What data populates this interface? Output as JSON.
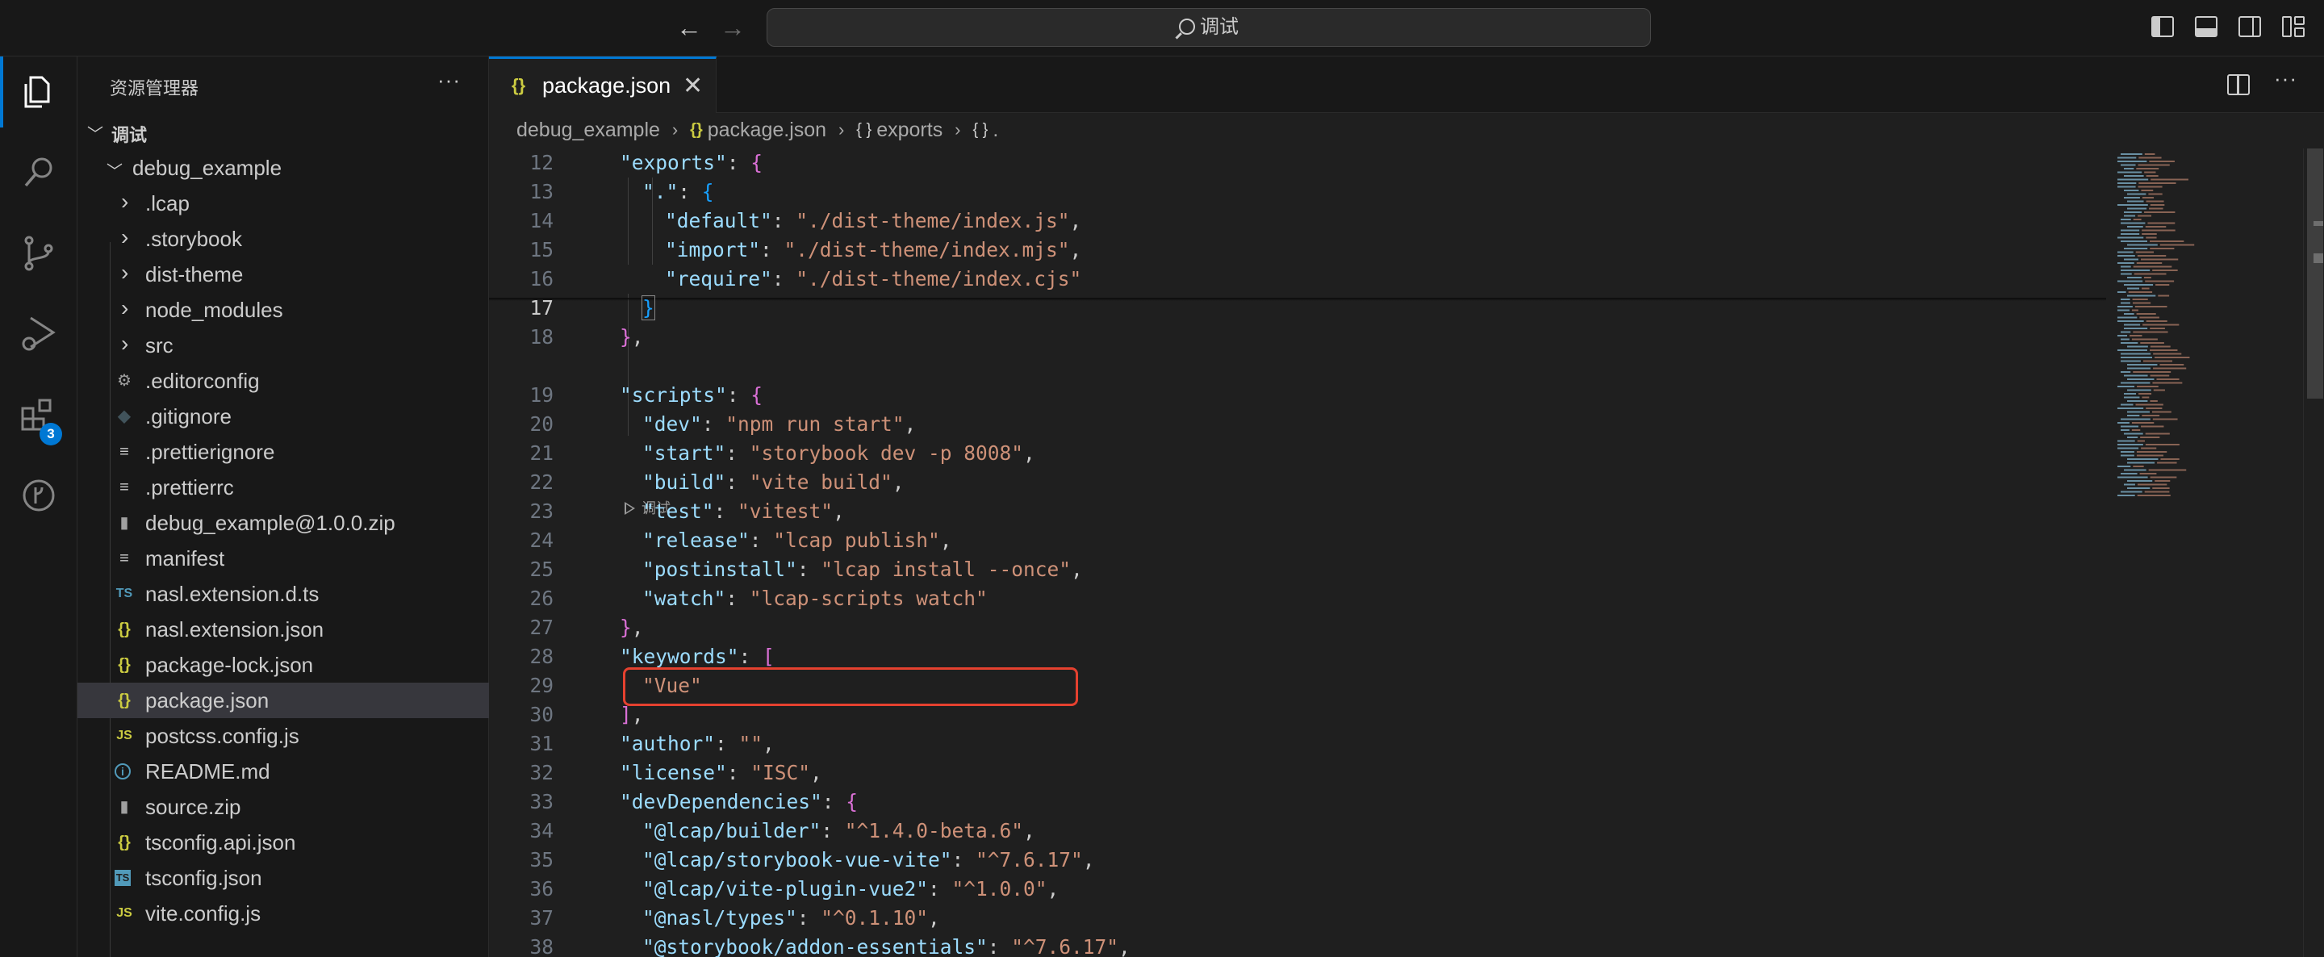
{
  "titlebar": {
    "search_text": "调试",
    "back_icon": "arrow-left-icon",
    "forward_icon": "arrow-right-icon"
  },
  "activitybar": {
    "items": [
      {
        "name": "explorer-icon",
        "active": true
      },
      {
        "name": "search-icon"
      },
      {
        "name": "source-control-icon"
      },
      {
        "name": "run-debug-icon"
      },
      {
        "name": "extensions-icon",
        "badge": "3"
      },
      {
        "name": "remote-explorer-icon"
      }
    ]
  },
  "sidebar": {
    "title": "资源管理器",
    "more": "···",
    "root_label": "调试",
    "items": [
      {
        "label": "debug_example",
        "type": "folder-open"
      },
      {
        "label": ".lcap",
        "type": "folder"
      },
      {
        "label": ".storybook",
        "type": "folder"
      },
      {
        "label": "dist-theme",
        "type": "folder"
      },
      {
        "label": "node_modules",
        "type": "folder"
      },
      {
        "label": "src",
        "type": "folder"
      },
      {
        "label": ".editorconfig",
        "type": "gear"
      },
      {
        "label": ".gitignore",
        "type": "git"
      },
      {
        "label": ".prettierignore",
        "type": "lines"
      },
      {
        "label": ".prettierrc",
        "type": "lines"
      },
      {
        "label": "debug_example@1.0.0.zip",
        "type": "zip"
      },
      {
        "label": "manifest",
        "type": "lines"
      },
      {
        "label": "nasl.extension.d.ts",
        "type": "ts",
        "icon_text": "TS"
      },
      {
        "label": "nasl.extension.json",
        "type": "json",
        "icon_text": "{}"
      },
      {
        "label": "package-lock.json",
        "type": "json",
        "icon_text": "{}"
      },
      {
        "label": "package.json",
        "type": "json",
        "icon_text": "{}",
        "selected": true
      },
      {
        "label": "postcss.config.js",
        "type": "js",
        "icon_text": "JS"
      },
      {
        "label": "README.md",
        "type": "info",
        "icon_text": "i"
      },
      {
        "label": "source.zip",
        "type": "zip"
      },
      {
        "label": "tsconfig.api.json",
        "type": "json",
        "icon_text": "{}"
      },
      {
        "label": "tsconfig.json",
        "type": "tsconfig",
        "icon_text": "TS"
      },
      {
        "label": "vite.config.js",
        "type": "js",
        "icon_text": "JS"
      }
    ]
  },
  "editor": {
    "tab": {
      "label": "package.json",
      "icon": "{}",
      "close": "✕"
    },
    "breadcrumb": [
      "debug_example",
      "package.json",
      "exports",
      "."
    ],
    "codelens": "调试",
    "line_numbers": [
      "12",
      "13",
      "14",
      "15",
      "16",
      "17",
      "18",
      "19",
      "20",
      "21",
      "22",
      "23",
      "24",
      "25",
      "26",
      "27",
      "28",
      "29",
      "30",
      "31",
      "32",
      "33",
      "34",
      "35",
      "36",
      "37",
      "38"
    ]
  },
  "colors": {
    "accent": "#0078d4",
    "highlight_box": "#e5412f",
    "json_icon": "#cbcb41",
    "js_icon": "#cbcb41",
    "ts_icon": "#519aba",
    "string": "#ce9178",
    "key": "#9cdcfe"
  }
}
